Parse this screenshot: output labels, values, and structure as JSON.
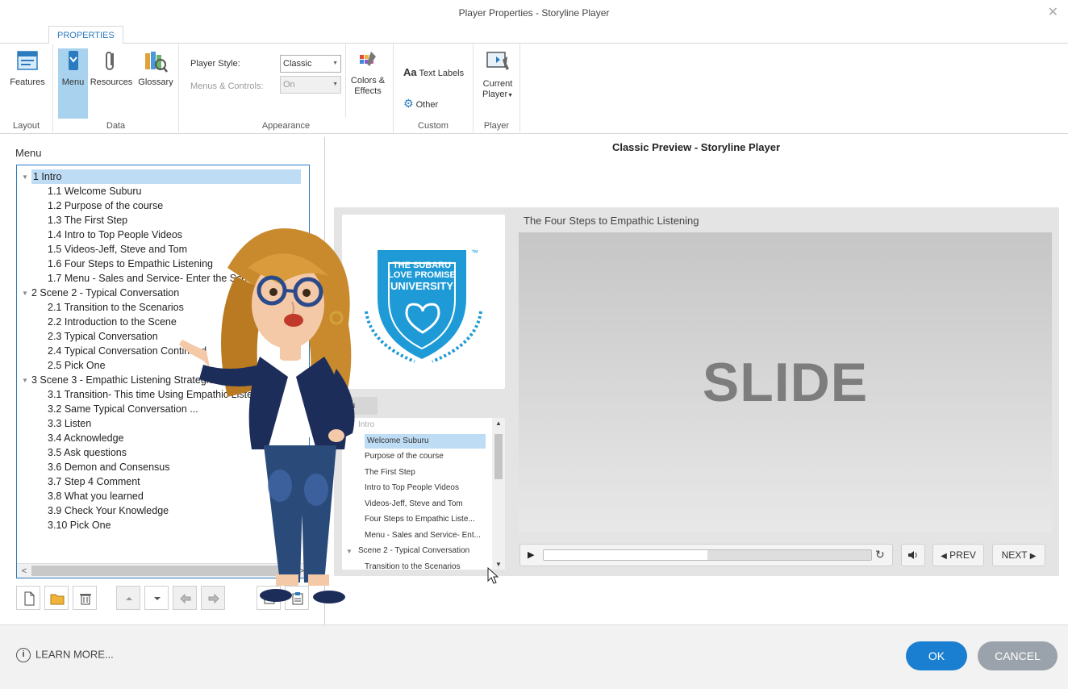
{
  "window": {
    "title": "Player Properties - Storyline Player"
  },
  "ribbon": {
    "tab": "PROPERTIES",
    "groups": {
      "layout": {
        "label": "Layout",
        "features": "Features"
      },
      "data": {
        "label": "Data",
        "menu": "Menu",
        "resources": "Resources",
        "glossary": "Glossary"
      },
      "appearance": {
        "label": "Appearance",
        "player_style_label": "Player Style:",
        "player_style_value": "Classic",
        "menus_controls_label": "Menus & Controls:",
        "menus_controls_value": "On",
        "colors_effects_1": "Colors &",
        "colors_effects_2": "Effects"
      },
      "custom": {
        "label": "Custom",
        "text_labels": "Text Labels",
        "other": "Other",
        "aa": "Aa"
      },
      "player": {
        "label": "Player",
        "current_1": "Current",
        "current_2": "Player"
      }
    }
  },
  "menu_panel": {
    "title": "Menu",
    "items": [
      {
        "text": "1 Intro",
        "level": 0,
        "selected": true
      },
      {
        "text": "1.1 Welcome Suburu",
        "level": 1
      },
      {
        "text": "1.2 Purpose of the course",
        "level": 1
      },
      {
        "text": "1.3 The First Step",
        "level": 1
      },
      {
        "text": "1.4 Intro to Top People Videos",
        "level": 1
      },
      {
        "text": "1.5 Videos-Jeff, Steve and Tom",
        "level": 1
      },
      {
        "text": "1.6 Four Steps to Empathic Listening",
        "level": 1
      },
      {
        "text": "1.7 Menu - Sales and Service- Enter the Sce",
        "level": 1
      },
      {
        "text": "2 Scene 2 - Typical Conversation",
        "level": 0
      },
      {
        "text": "2.1 Transition to the Scenarios",
        "level": 1
      },
      {
        "text": "2.2 Introduction to the Scene",
        "level": 1
      },
      {
        "text": "2.3 Typical Conversation",
        "level": 1
      },
      {
        "text": "2.4 Typical Conversation Continued",
        "level": 1
      },
      {
        "text": "2.5 Pick One",
        "level": 1
      },
      {
        "text": "3 Scene 3 - Empathic Listening Strategies",
        "level": 0
      },
      {
        "text": "3.1 Transition- This time Using Empathic Listening",
        "level": 1
      },
      {
        "text": "3.2 Same Typical Conversation ...",
        "level": 1
      },
      {
        "text": "3.3 Listen",
        "level": 1
      },
      {
        "text": "3.4 Acknowledge",
        "level": 1
      },
      {
        "text": "3.5 Ask questions",
        "level": 1
      },
      {
        "text": "3.6 Demon and Consensus",
        "level": 1
      },
      {
        "text": "3.7 Step 4 Comment",
        "level": 1
      },
      {
        "text": "3.8 What you learned",
        "level": 1
      },
      {
        "text": "3.9 Check Your Knowledge",
        "level": 1
      },
      {
        "text": "3.10 Pick One",
        "level": 1
      }
    ]
  },
  "preview": {
    "title": "Classic Preview - Storyline Player",
    "logo": {
      "line1": "THE SUBARU",
      "line2": "LOVE PROMISE",
      "line3": "UNIVERSITY",
      "tm": "™"
    },
    "menu_tab": "nu",
    "menu_items": [
      {
        "text": "Intro",
        "level": 0,
        "faded": true
      },
      {
        "text": "Welcome Suburu",
        "level": 1,
        "selected": true
      },
      {
        "text": "Purpose of the course",
        "level": 1
      },
      {
        "text": "The First Step",
        "level": 1
      },
      {
        "text": "Intro to Top People Videos",
        "level": 1
      },
      {
        "text": "Videos-Jeff, Steve and Tom",
        "level": 1
      },
      {
        "text": "Four Steps to Empathic Liste...",
        "level": 1
      },
      {
        "text": "Menu - Sales and Service- Ent...",
        "level": 1
      },
      {
        "text": "Scene 2 - Typical Conversation",
        "level": 0
      },
      {
        "text": "Transition to the Scenarios",
        "level": 1
      }
    ],
    "slide_title": "The Four Steps to Empathic Listening",
    "slide_text": "SLIDE",
    "seek_progress": 0.5,
    "prev_label": "PREV",
    "next_label": "NEXT"
  },
  "footer": {
    "learn_more": "LEARN MORE...",
    "ok": "OK",
    "cancel": "CANCEL"
  },
  "colors": {
    "accent": "#1a7fd0",
    "selection": "#bfdcf5",
    "ribbon_active": "#a9d2ee",
    "logo_blue": "#1e9ad6"
  }
}
